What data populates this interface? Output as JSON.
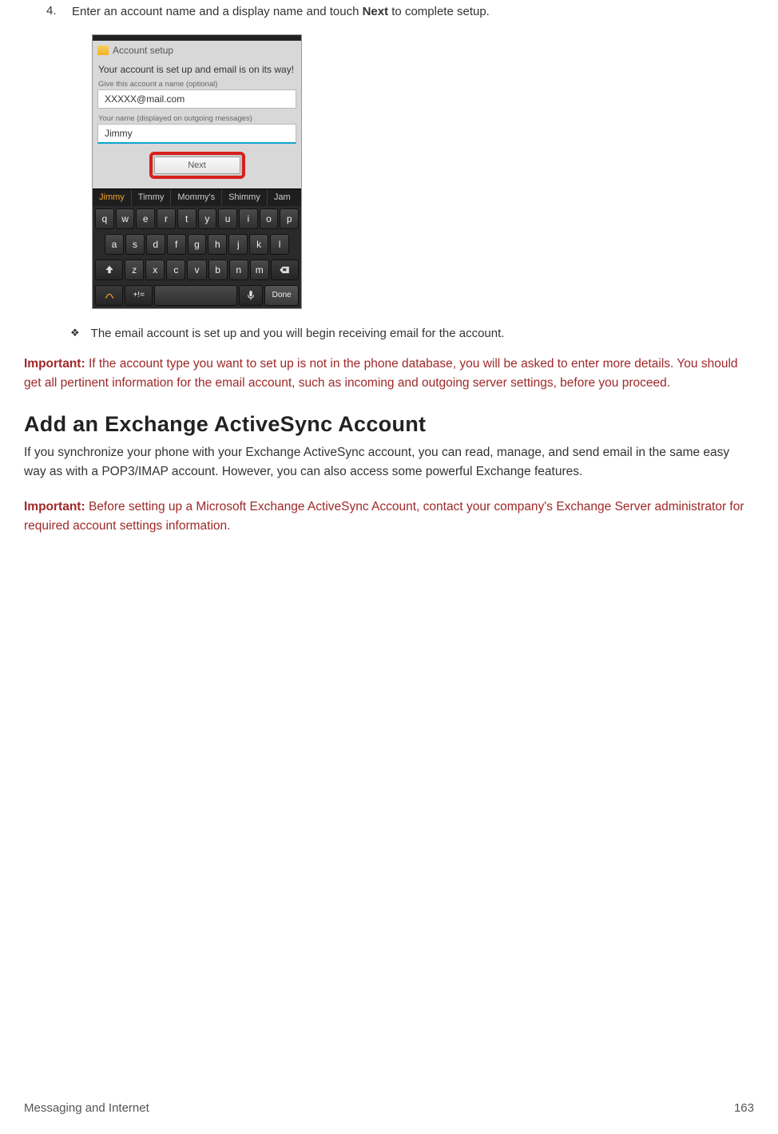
{
  "step": {
    "number": "4.",
    "text_before": "Enter an account name and a display name and touch ",
    "bold": "Next",
    "text_after": " to complete setup."
  },
  "phone": {
    "title": "Account setup",
    "message": "Your account is set up and email is on its way!",
    "label_account": "Give this account a name (optional)",
    "input_account": "XXXXX@mail.com",
    "label_name": "Your name (displayed on outgoing messages)",
    "input_name": "Jimmy",
    "next_button": "Next",
    "suggestions": [
      "Jimmy",
      "Timmy",
      "Mommy's",
      "Shimmy",
      "Jam"
    ],
    "row1": [
      "q",
      "w",
      "e",
      "r",
      "t",
      "y",
      "u",
      "i",
      "o",
      "p"
    ],
    "row2": [
      "a",
      "s",
      "d",
      "f",
      "g",
      "h",
      "j",
      "k",
      "l"
    ],
    "row3_keys": [
      "z",
      "x",
      "c",
      "v",
      "b",
      "n",
      "m"
    ],
    "row4_sym": "+!=",
    "done": "Done"
  },
  "bullet": {
    "symbol": "❖",
    "text": "The email account is set up and you will begin receiving email for the account."
  },
  "important1": {
    "label": "Important:",
    "text": " If the account type you want to set up is not in the phone database, you will be asked to enter more details. You should get all pertinent information for the email account, such as incoming and outgoing server settings, before you proceed."
  },
  "section": {
    "title": "Add an Exchange ActiveSync Account",
    "para": "If you synchronize your phone with your Exchange ActiveSync account, you can read, manage, and send email in the same easy way as with a POP3/IMAP account. However, you can also access some powerful Exchange features."
  },
  "important2": {
    "label": "Important:",
    "text": " Before setting up a Microsoft Exchange ActiveSync Account, contact your company's Exchange Server administrator for required account settings information."
  },
  "footer": {
    "left": "Messaging and Internet",
    "right": "163"
  }
}
